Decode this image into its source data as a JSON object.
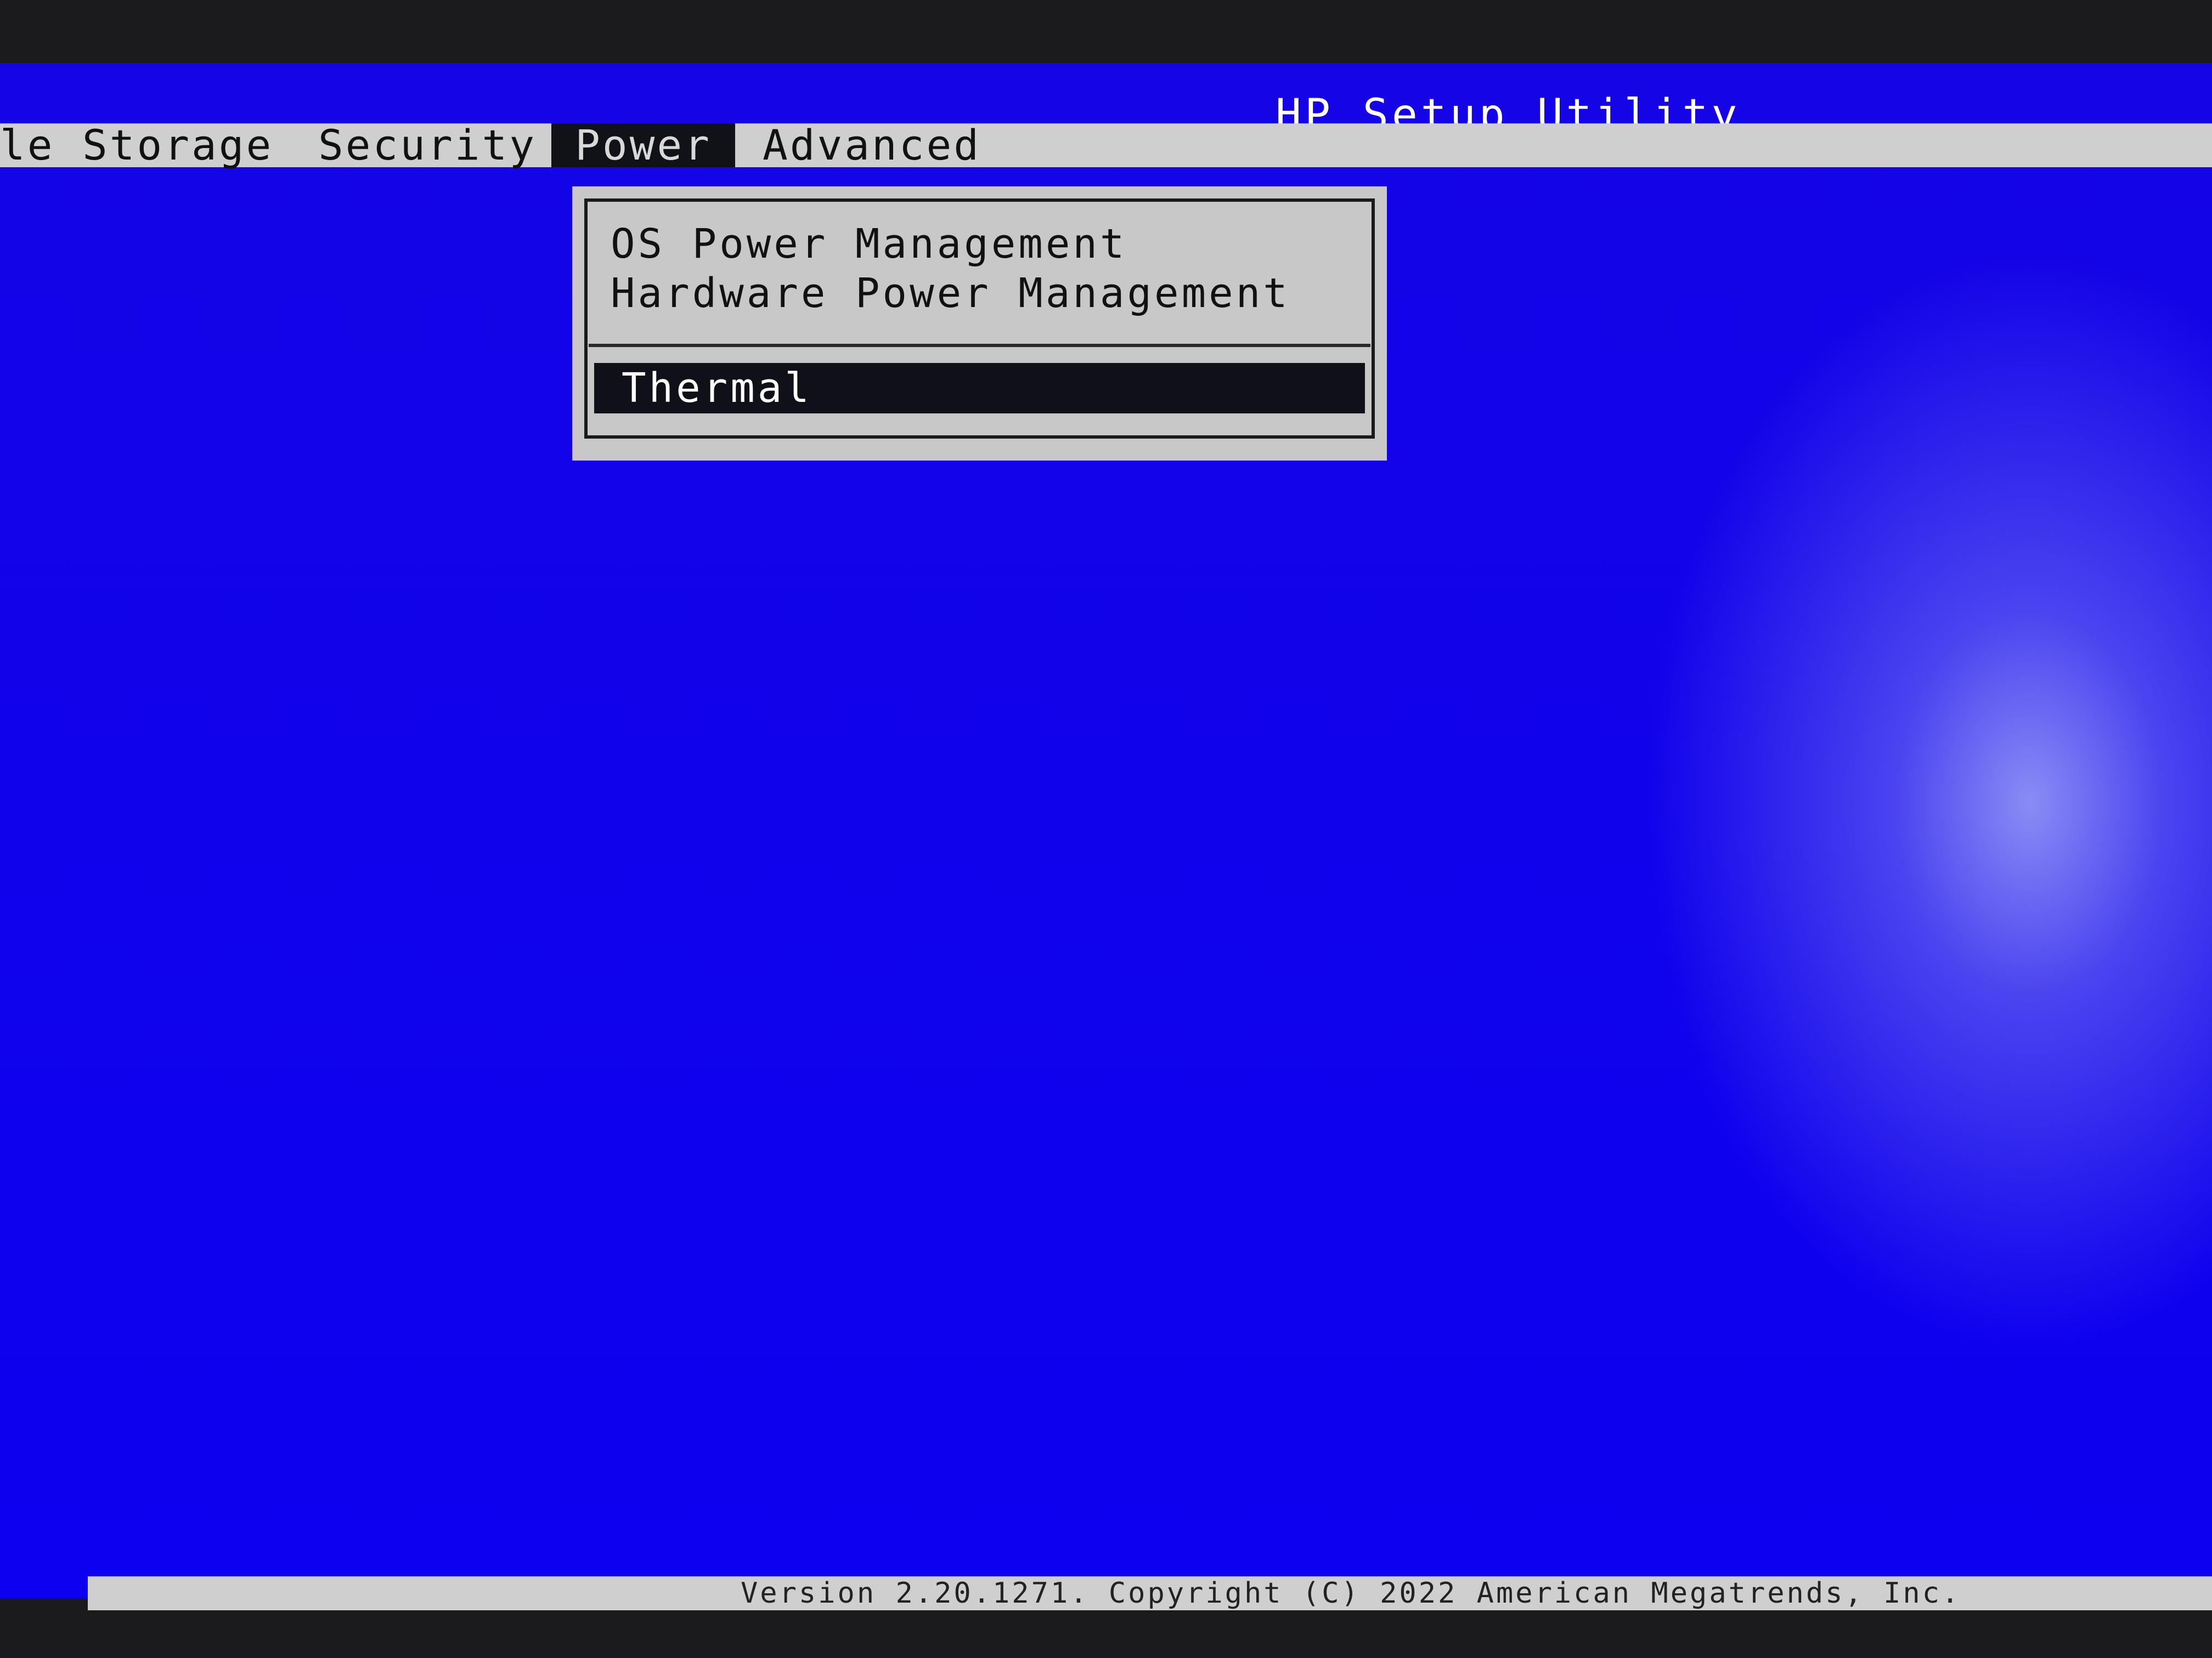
{
  "app": {
    "title": "HP Setup Utility"
  },
  "menubar": {
    "items": [
      {
        "label": "le"
      },
      {
        "label": "Storage"
      },
      {
        "label": "Security"
      },
      {
        "label": "Power"
      },
      {
        "label": "Advanced"
      }
    ],
    "active": "Power"
  },
  "dropdown": {
    "items": [
      {
        "label": "OS Power Management"
      },
      {
        "label": "Hardware Power Management"
      }
    ],
    "selected": {
      "label": "Thermal"
    }
  },
  "footer": {
    "text": "Version 2.20.1271. Copyright (C) 2022 American Megatrends, Inc."
  },
  "colors": {
    "background": "#0c00f0",
    "menubar": "#cfcfcf",
    "highlight": "#111118"
  }
}
